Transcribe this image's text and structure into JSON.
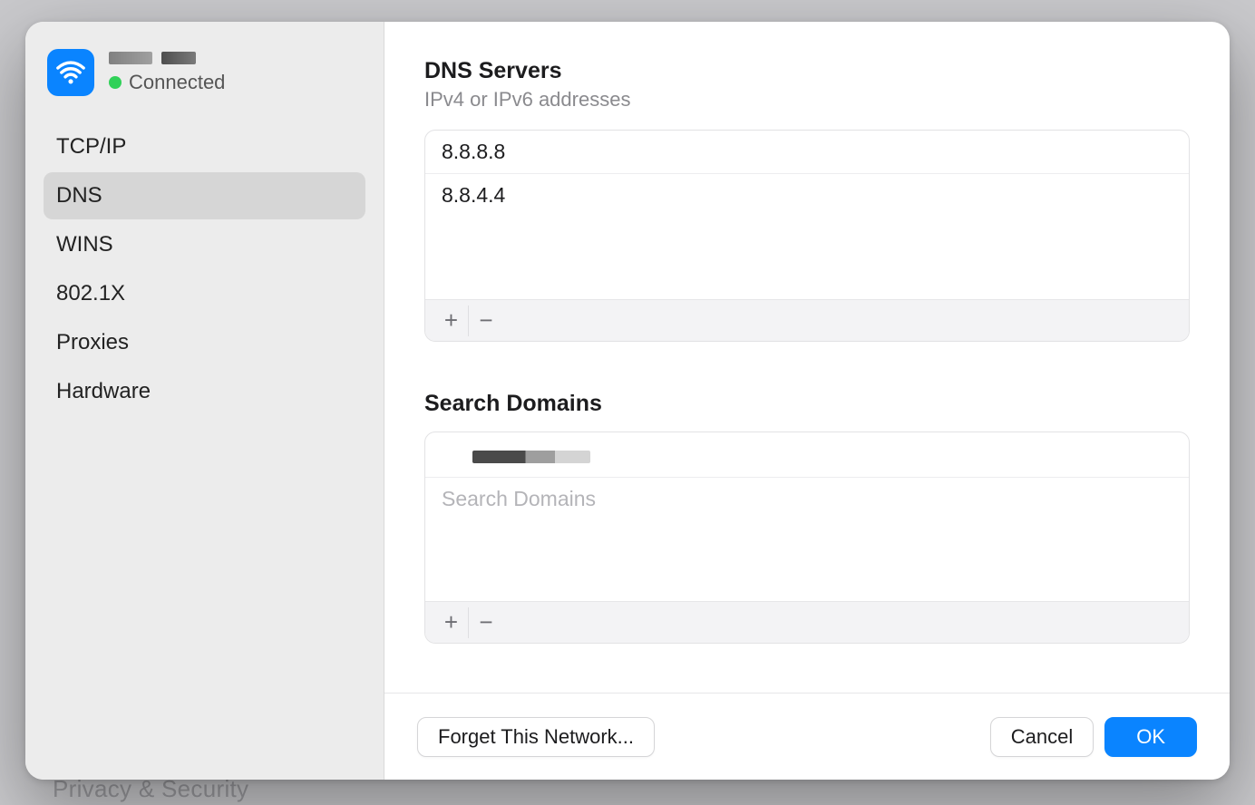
{
  "background": {
    "partial_item_text": "Privacy & Security"
  },
  "sidebar": {
    "connection_name": "",
    "status_label": "Connected",
    "nav": [
      {
        "id": "tcpip",
        "label": "TCP/IP",
        "selected": false
      },
      {
        "id": "dns",
        "label": "DNS",
        "selected": true
      },
      {
        "id": "wins",
        "label": "WINS",
        "selected": false
      },
      {
        "id": "8021x",
        "label": "802.1X",
        "selected": false
      },
      {
        "id": "proxies",
        "label": "Proxies",
        "selected": false
      },
      {
        "id": "hardware",
        "label": "Hardware",
        "selected": false
      }
    ]
  },
  "content": {
    "dns_servers": {
      "title": "DNS Servers",
      "subtitle": "IPv4 or IPv6 addresses",
      "rows": [
        "8.8.8.8",
        "8.8.4.4"
      ],
      "add_label": "+",
      "remove_label": "−"
    },
    "search_domains": {
      "title": "Search Domains",
      "rows": [
        ""
      ],
      "placeholder": "Search Domains",
      "add_label": "+",
      "remove_label": "−"
    }
  },
  "footer": {
    "forget_label": "Forget This Network...",
    "cancel_label": "Cancel",
    "ok_label": "OK"
  }
}
